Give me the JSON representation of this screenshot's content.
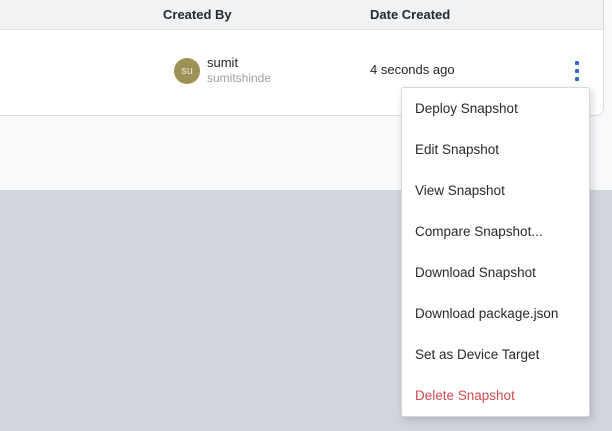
{
  "colors": {
    "header_bg": "#f1f2f4",
    "card_border": "#d9dbde",
    "section_light": "#f8f9fb",
    "section_dark": "#d2d5dc",
    "kebab_blue": "#3366d6",
    "danger_red": "#d04a4f",
    "avatar_bg": "#9e9155"
  },
  "table": {
    "columns": [
      {
        "label": "Created By"
      },
      {
        "label": "Date Created"
      }
    ],
    "row": {
      "user": {
        "initials": "su",
        "name": "sumit",
        "username": "sumitshinde"
      },
      "date_created": "4 seconds ago"
    }
  },
  "menu": {
    "items": [
      {
        "label": "Deploy Snapshot"
      },
      {
        "label": "Edit Snapshot"
      },
      {
        "label": "View Snapshot"
      },
      {
        "label": "Compare Snapshot..."
      },
      {
        "label": "Download Snapshot"
      },
      {
        "label": "Download package.json"
      },
      {
        "label": "Set as Device Target"
      },
      {
        "label": "Delete Snapshot",
        "danger": true
      }
    ]
  }
}
